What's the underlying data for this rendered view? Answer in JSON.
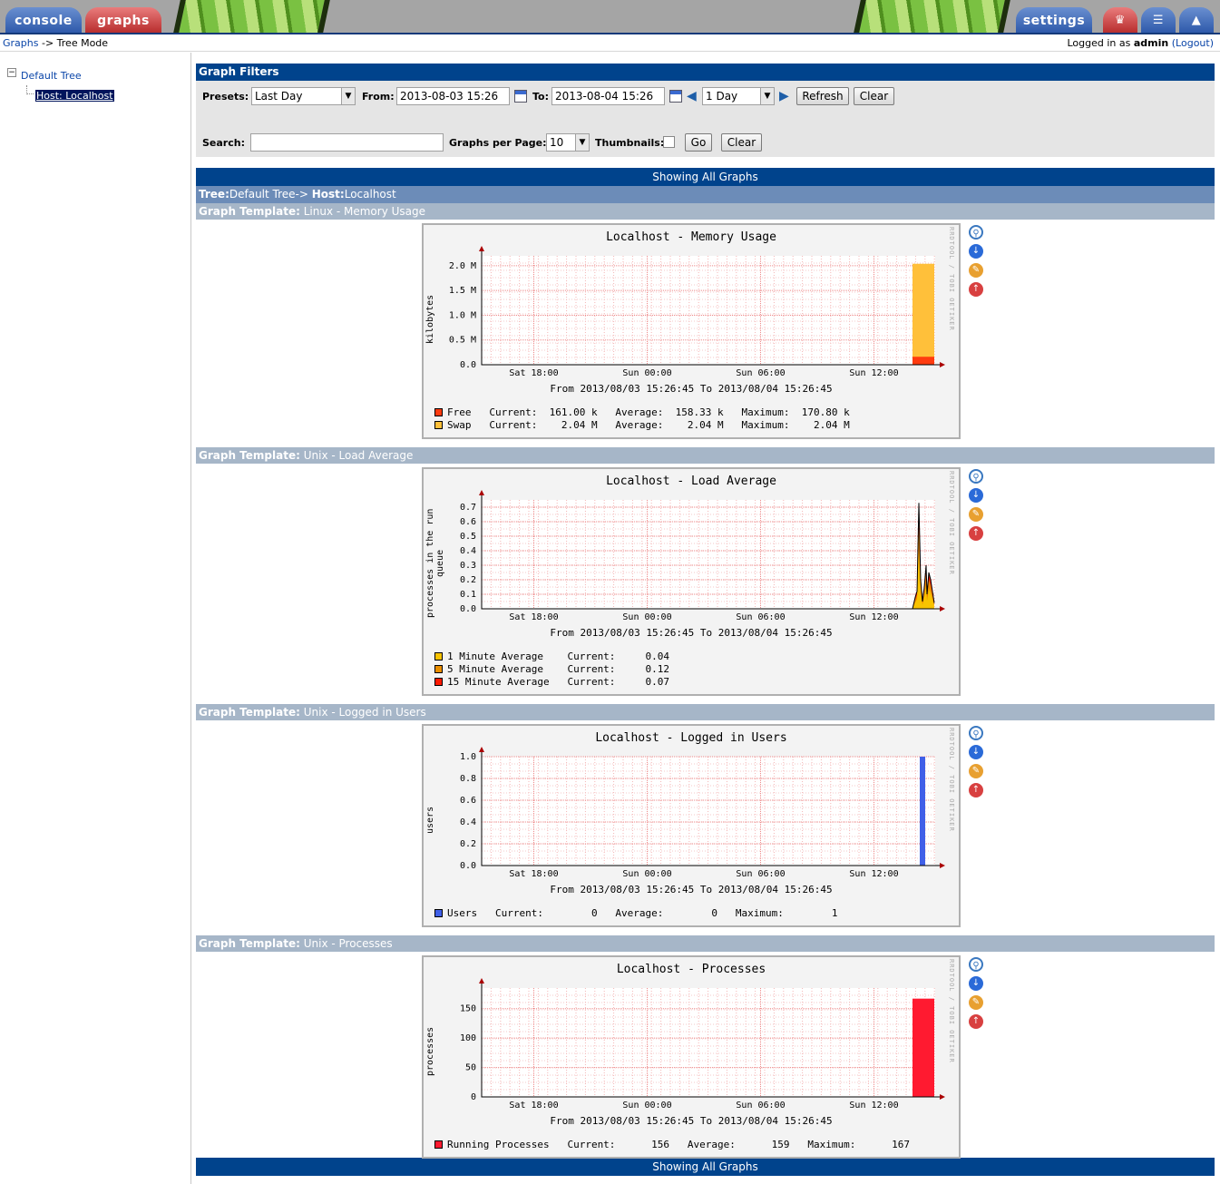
{
  "nav": {
    "console": "console",
    "graphs": "graphs",
    "settings": "settings"
  },
  "breadcrumb": {
    "graphs": "Graphs",
    "sep": " -> ",
    "mode": "Tree Mode"
  },
  "user": {
    "prefix": "Logged in as ",
    "name": "admin",
    "logout": "(Logout)"
  },
  "tree": {
    "root": "Default Tree",
    "host": "Host: Localhost"
  },
  "filters": {
    "title": "Graph Filters",
    "presets_label": "Presets:",
    "presets_value": "Last Day",
    "from_label": "From:",
    "from_value": "2013-08-03 15:26",
    "to_label": "To:",
    "to_value": "2013-08-04 15:26",
    "span_value": "1 Day",
    "refresh": "Refresh",
    "clear": "Clear",
    "search_label": "Search:",
    "search_value": "",
    "gpp_label": "Graphs per Page:",
    "gpp_value": "10",
    "thumbs_label": "Thumbnails:",
    "go": "Go",
    "clear2": "Clear"
  },
  "showing": "Showing All Graphs",
  "treepath": {
    "tree_label": "Tree:",
    "tree_name": "Default Tree",
    "arrow": "-> ",
    "host_label": "Host:",
    "host_name": "Localhost"
  },
  "template_label": "Graph Template:",
  "graph_icons": [
    "zoom-icon",
    "download-icon",
    "edit-icon",
    "move-up-icon"
  ],
  "rrd_credit": "RRDTOOL / TOBI OETIKER",
  "graphs": [
    {
      "template": "Linux - Memory Usage",
      "title": "Localhost - Memory Usage",
      "ylabel": "kilobytes",
      "range": "From 2013/08/03 15:26:45 To 2013/08/04 15:26:45",
      "xticks": [
        "Sat 18:00",
        "Sun 00:00",
        "Sun 06:00",
        "Sun 12:00"
      ],
      "legend": [
        {
          "color": "#ff3b0f",
          "text": "Free   Current:  161.00 k   Average:  158.33 k   Maximum:  170.80 k"
        },
        {
          "color": "#ffc03a",
          "text": "Swap   Current:    2.04 M   Average:    2.04 M   Maximum:    2.04 M"
        }
      ]
    },
    {
      "template": "Unix - Load Average",
      "title": "Localhost - Load Average",
      "ylabel": "processes in the run queue",
      "range": "From 2013/08/03 15:26:45 To 2013/08/04 15:26:45",
      "xticks": [
        "Sat 18:00",
        "Sun 00:00",
        "Sun 06:00",
        "Sun 12:00"
      ],
      "legend": [
        {
          "color": "#f8c300",
          "text": "1 Minute Average    Current:     0.04"
        },
        {
          "color": "#ea8f00",
          "text": "5 Minute Average    Current:     0.12"
        },
        {
          "color": "#ff1a00",
          "text": "15 Minute Average   Current:     0.07"
        }
      ]
    },
    {
      "template": "Unix - Logged in Users",
      "title": "Localhost - Logged in Users",
      "ylabel": "users",
      "range": "From 2013/08/03 15:26:45 To 2013/08/04 15:26:45",
      "xticks": [
        "Sat 18:00",
        "Sun 00:00",
        "Sun 06:00",
        "Sun 12:00"
      ],
      "legend": [
        {
          "color": "#4060e8",
          "text": "Users   Current:        0   Average:        0   Maximum:        1"
        }
      ]
    },
    {
      "template": "Unix - Processes",
      "title": "Localhost - Processes",
      "ylabel": "processes",
      "range": "From 2013/08/03 15:26:45 To 2013/08/04 15:26:45",
      "xticks": [
        "Sat 18:00",
        "Sun 00:00",
        "Sun 06:00",
        "Sun 12:00"
      ],
      "legend": [
        {
          "color": "#ff1a30",
          "text": "Running Processes   Current:      156   Average:      159   Maximum:      167"
        }
      ]
    }
  ],
  "chart_data": [
    {
      "type": "area",
      "title": "Localhost - Memory Usage",
      "ylabel": "kilobytes",
      "ylim": [
        0,
        2200000
      ],
      "yticks": [
        "0.0",
        "0.5 M",
        "1.0 M",
        "1.5 M",
        "2.0 M"
      ],
      "xticks": [
        "Sat 18:00",
        "Sun 00:00",
        "Sun 06:00",
        "Sun 12:00"
      ],
      "series": [
        {
          "name": "Free",
          "color": "#ff3b0f",
          "current": 161000,
          "average": 158330,
          "maximum": 170800
        },
        {
          "name": "Swap",
          "color": "#ffc03a",
          "current": 2040000,
          "average": 2040000,
          "maximum": 2040000
        }
      ]
    },
    {
      "type": "area",
      "title": "Localhost - Load Average",
      "ylabel": "processes in the run queue",
      "ylim": [
        0,
        0.75
      ],
      "yticks": [
        "0.0",
        "0.1",
        "0.2",
        "0.3",
        "0.4",
        "0.5",
        "0.6",
        "0.7"
      ],
      "xticks": [
        "Sat 18:00",
        "Sun 00:00",
        "Sun 06:00",
        "Sun 12:00"
      ],
      "series": [
        {
          "name": "1 Minute Average",
          "color": "#f8c300",
          "current": 0.04
        },
        {
          "name": "5 Minute Average",
          "color": "#ea8f00",
          "current": 0.12
        },
        {
          "name": "15 Minute Average",
          "color": "#ff1a00",
          "current": 0.07
        }
      ]
    },
    {
      "type": "area",
      "title": "Localhost - Logged in Users",
      "ylabel": "users",
      "ylim": [
        0,
        1.0
      ],
      "yticks": [
        "0.0",
        "0.2",
        "0.4",
        "0.6",
        "0.8",
        "1.0"
      ],
      "xticks": [
        "Sat 18:00",
        "Sun 00:00",
        "Sun 06:00",
        "Sun 12:00"
      ],
      "series": [
        {
          "name": "Users",
          "color": "#4060e8",
          "current": 0,
          "average": 0,
          "maximum": 1
        }
      ]
    },
    {
      "type": "area",
      "title": "Localhost - Processes",
      "ylabel": "processes",
      "ylim": [
        0,
        185
      ],
      "yticks": [
        "0",
        "50",
        "100",
        "150"
      ],
      "xticks": [
        "Sat 18:00",
        "Sun 00:00",
        "Sun 06:00",
        "Sun 12:00"
      ],
      "series": [
        {
          "name": "Running Processes",
          "color": "#ff1a30",
          "current": 156,
          "average": 159,
          "maximum": 167
        }
      ]
    }
  ]
}
